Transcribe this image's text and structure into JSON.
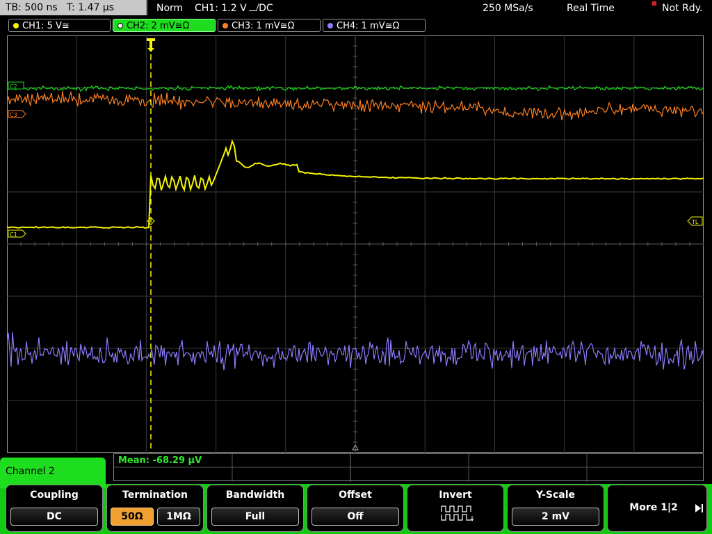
{
  "topbar": {
    "timebase": "TB: 500 ns",
    "trigger_time": "T: 1.47 µs",
    "mode": "Norm",
    "trigger_info": "CH1: 1.2 V",
    "trigger_coupling": "DC",
    "sample_rate": "250 MSa/s",
    "acq_mode": "Real Time",
    "status": "Not Rdy."
  },
  "channels": [
    {
      "label": "CH1: 5 V≅",
      "color": "#f5f500"
    },
    {
      "label": "CH2: 2 mV≅Ω",
      "color": "#1edc1e"
    },
    {
      "label": "CH3: 1 mV≅Ω",
      "color": "#ff8020"
    },
    {
      "label": "CH4: 1 mV≅Ω",
      "color": "#8c7cff"
    }
  ],
  "markers": {
    "c1": "C1",
    "c2": "C2",
    "c3": "C3",
    "trigger_level": "TL"
  },
  "measurement": {
    "label": "Mean: -68.29 µV"
  },
  "menu": {
    "title": "Channel 2",
    "softkeys": [
      {
        "title": "Coupling",
        "value": "DC"
      },
      {
        "title": "Termination",
        "value_a": "50Ω",
        "value_b": "1MΩ"
      },
      {
        "title": "Bandwidth",
        "value": "Full"
      },
      {
        "title": "Offset",
        "value": "Off"
      },
      {
        "title": "Invert"
      },
      {
        "title": "Y-Scale",
        "value": "2 mV"
      },
      {
        "title": "More 1|2"
      }
    ]
  }
}
